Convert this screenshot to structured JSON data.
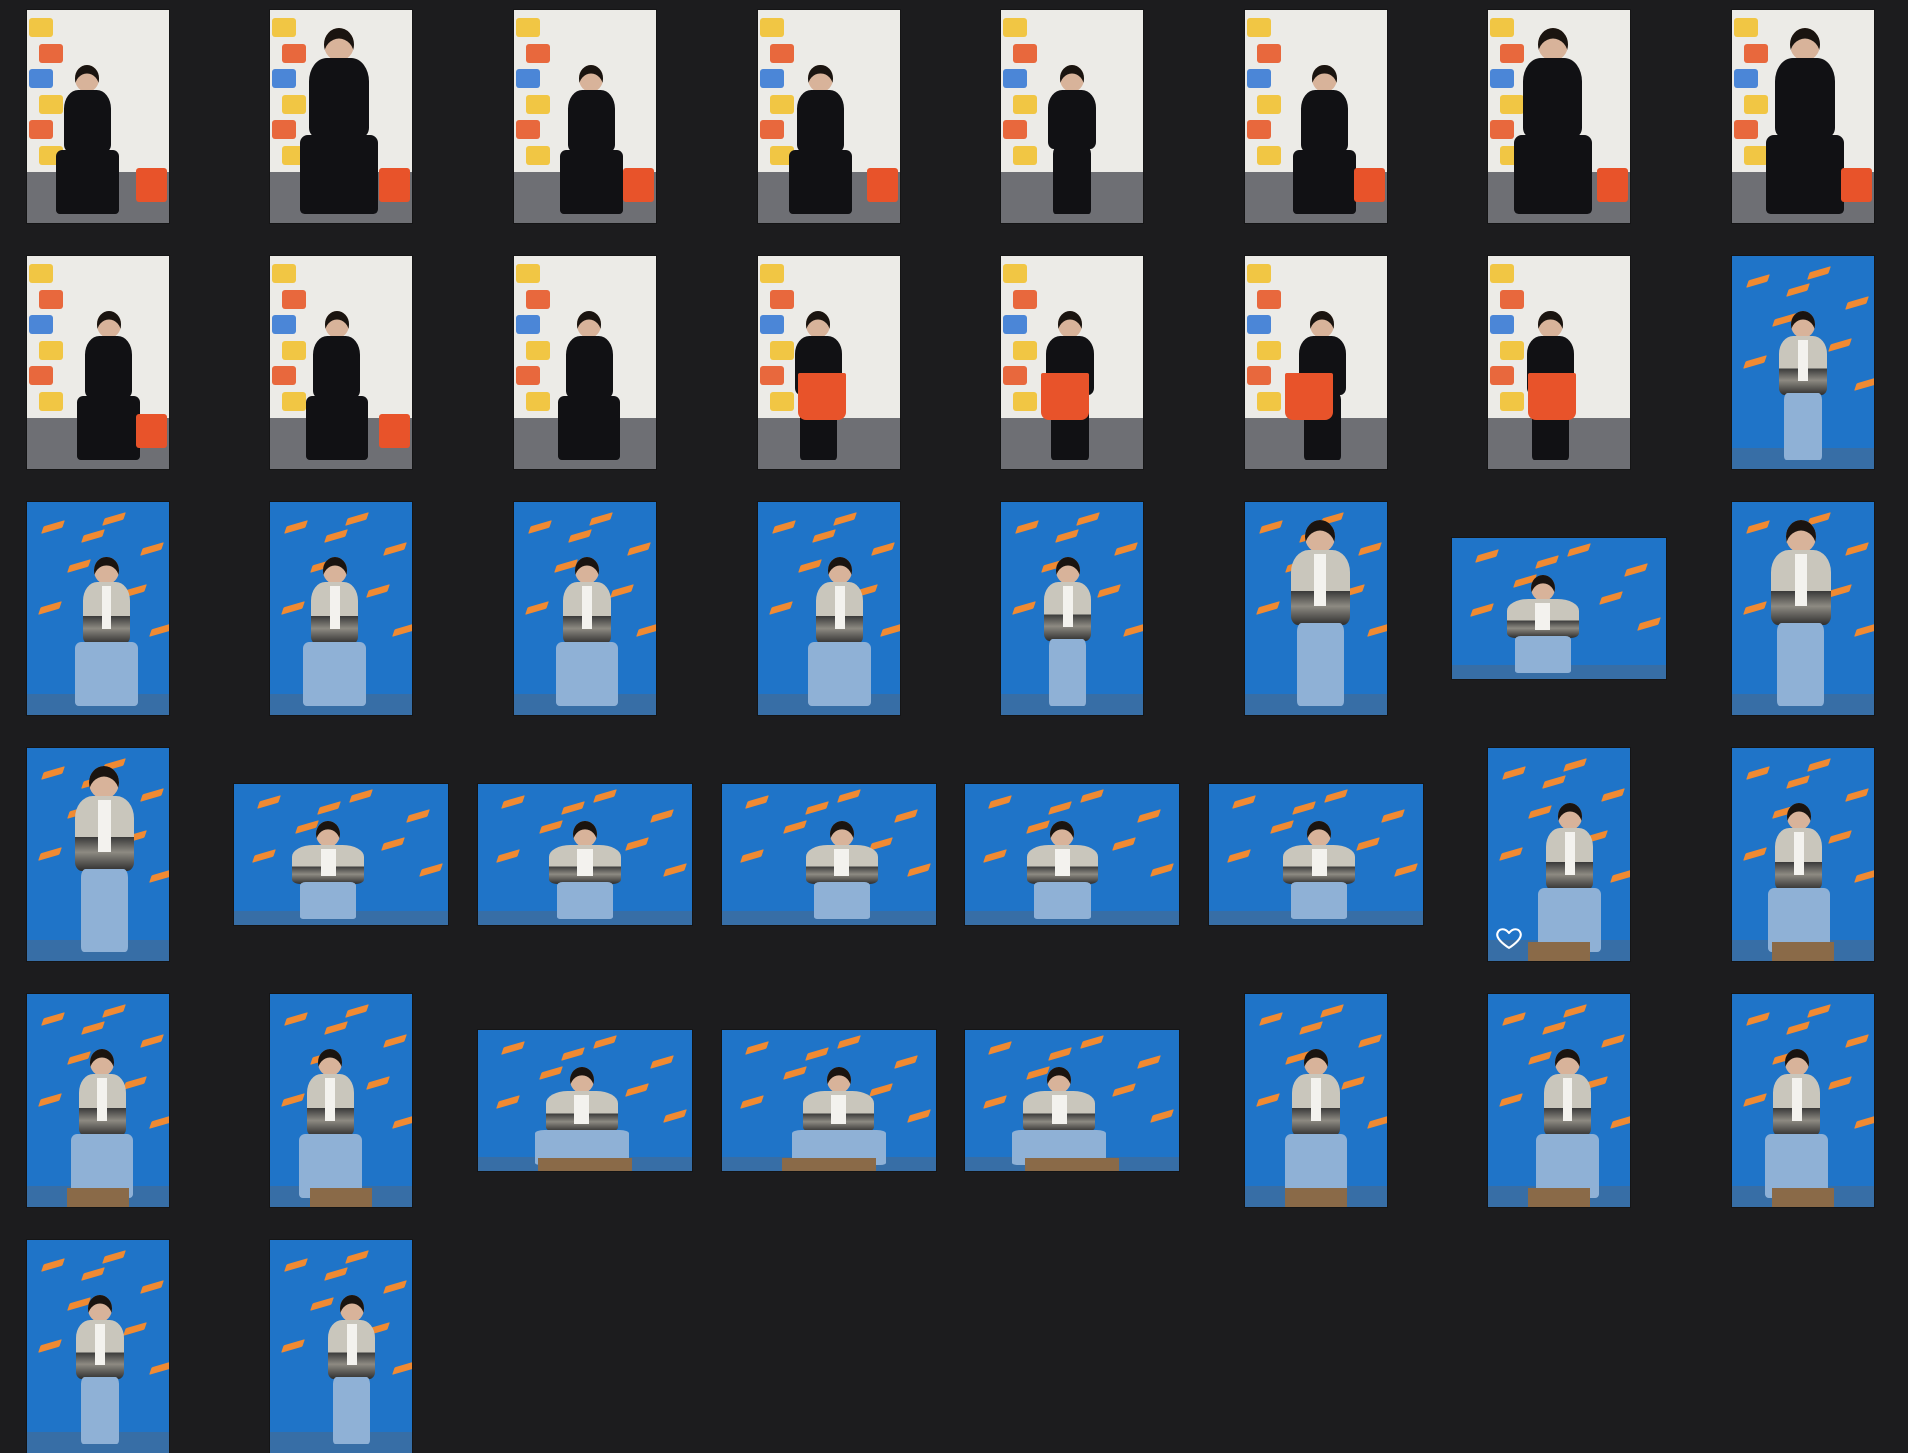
{
  "app": {
    "view": "photo-grid"
  },
  "colors": {
    "background": "#1c1c1e",
    "wall_white": "#ecebe7",
    "floor_grey": "#6e6f74",
    "wall_blue": "#1f74c8",
    "bolt_orange": "#f08a32",
    "bag_orange": "#e8532a",
    "black_outfit": "#111114",
    "jacket_grey": "#c9c6bc",
    "jeans": "#8fb1d6",
    "skin": "#d8b39a",
    "hair_dark": "#1a1410",
    "box_wood": "#8a6a48"
  },
  "favorite_icon": {
    "name": "heart-outline-icon",
    "state": "not-favorited"
  },
  "thumbnails": [
    {
      "scene": "white-wall",
      "pose": "seated",
      "orientation": "portrait"
    },
    {
      "scene": "white-wall",
      "pose": "seated-close",
      "orientation": "portrait"
    },
    {
      "scene": "white-wall",
      "pose": "seated",
      "orientation": "portrait"
    },
    {
      "scene": "white-wall",
      "pose": "seated",
      "orientation": "portrait"
    },
    {
      "scene": "white-wall",
      "pose": "leaning",
      "orientation": "portrait"
    },
    {
      "scene": "white-wall",
      "pose": "seated",
      "orientation": "portrait"
    },
    {
      "scene": "white-wall",
      "pose": "seated-close",
      "orientation": "portrait"
    },
    {
      "scene": "white-wall",
      "pose": "seated-close",
      "orientation": "portrait"
    },
    {
      "scene": "white-wall",
      "pose": "seated",
      "orientation": "portrait"
    },
    {
      "scene": "white-wall",
      "pose": "seated",
      "orientation": "portrait"
    },
    {
      "scene": "white-wall",
      "pose": "crouch",
      "orientation": "portrait"
    },
    {
      "scene": "white-wall",
      "pose": "standing-bag",
      "orientation": "portrait"
    },
    {
      "scene": "white-wall",
      "pose": "standing-bag",
      "orientation": "portrait"
    },
    {
      "scene": "white-wall",
      "pose": "standing-bag",
      "orientation": "portrait"
    },
    {
      "scene": "white-wall",
      "pose": "standing-bag",
      "orientation": "portrait"
    },
    {
      "scene": "blue-wall",
      "pose": "standing",
      "orientation": "portrait"
    },
    {
      "scene": "blue-wall",
      "pose": "crouch",
      "orientation": "portrait"
    },
    {
      "scene": "blue-wall",
      "pose": "crouch",
      "orientation": "portrait"
    },
    {
      "scene": "blue-wall",
      "pose": "crouch",
      "orientation": "portrait"
    },
    {
      "scene": "blue-wall",
      "pose": "crouch",
      "orientation": "portrait"
    },
    {
      "scene": "blue-wall",
      "pose": "standing",
      "orientation": "portrait"
    },
    {
      "scene": "blue-wall",
      "pose": "standing-close",
      "orientation": "portrait"
    },
    {
      "scene": "blue-wall",
      "pose": "standing",
      "orientation": "landscape"
    },
    {
      "scene": "blue-wall",
      "pose": "standing-close",
      "orientation": "portrait"
    },
    {
      "scene": "blue-wall",
      "pose": "standing-close",
      "orientation": "portrait"
    },
    {
      "scene": "blue-wall",
      "pose": "standing",
      "orientation": "landscape"
    },
    {
      "scene": "blue-wall",
      "pose": "standing",
      "orientation": "landscape"
    },
    {
      "scene": "blue-wall",
      "pose": "standing",
      "orientation": "landscape"
    },
    {
      "scene": "blue-wall",
      "pose": "standing",
      "orientation": "landscape"
    },
    {
      "scene": "blue-wall",
      "pose": "standing",
      "orientation": "landscape"
    },
    {
      "scene": "blue-wall",
      "pose": "box-crouch",
      "orientation": "portrait",
      "hovered": true
    },
    {
      "scene": "blue-wall",
      "pose": "box-crouch",
      "orientation": "portrait"
    },
    {
      "scene": "blue-wall",
      "pose": "box-crouch",
      "orientation": "portrait"
    },
    {
      "scene": "blue-wall",
      "pose": "box-crouch",
      "orientation": "portrait"
    },
    {
      "scene": "blue-wall",
      "pose": "box-crouch",
      "orientation": "landscape"
    },
    {
      "scene": "blue-wall",
      "pose": "box-crouch",
      "orientation": "landscape"
    },
    {
      "scene": "blue-wall",
      "pose": "box-crouch",
      "orientation": "landscape"
    },
    {
      "scene": "blue-wall",
      "pose": "box-crouch",
      "orientation": "portrait"
    },
    {
      "scene": "blue-wall",
      "pose": "box-crouch",
      "orientation": "portrait"
    },
    {
      "scene": "blue-wall",
      "pose": "box-crouch",
      "orientation": "portrait"
    },
    {
      "scene": "blue-wall",
      "pose": "partial",
      "orientation": "portrait"
    },
    {
      "scene": "blue-wall",
      "pose": "partial",
      "orientation": "portrait"
    }
  ]
}
